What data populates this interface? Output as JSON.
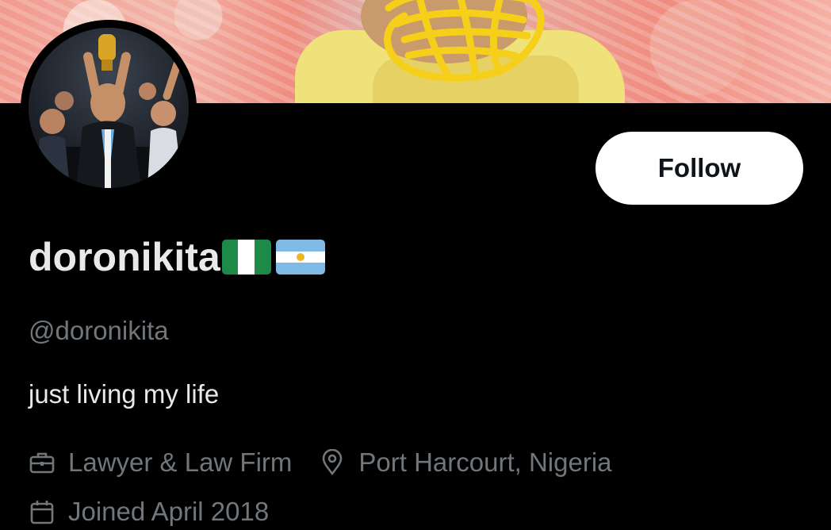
{
  "profile": {
    "display_name": "doronikita",
    "flags": [
      "nigeria-flag",
      "argentina-flag"
    ],
    "handle": "@doronikita",
    "bio": "just living my life",
    "category": "Lawyer & Law Firm",
    "location": "Port Harcourt, Nigeria",
    "joined": "Joined April 2018"
  },
  "actions": {
    "follow_label": "Follow"
  },
  "icons": {
    "category": "briefcase-icon",
    "location": "location-pin-icon",
    "joined": "calendar-icon"
  },
  "colors": {
    "background": "#000000",
    "primary_text": "#e7e9ea",
    "secondary_text": "#71767b",
    "button_bg": "#ffffff",
    "button_text": "#0f1419",
    "scribble": "#f5cf19"
  }
}
